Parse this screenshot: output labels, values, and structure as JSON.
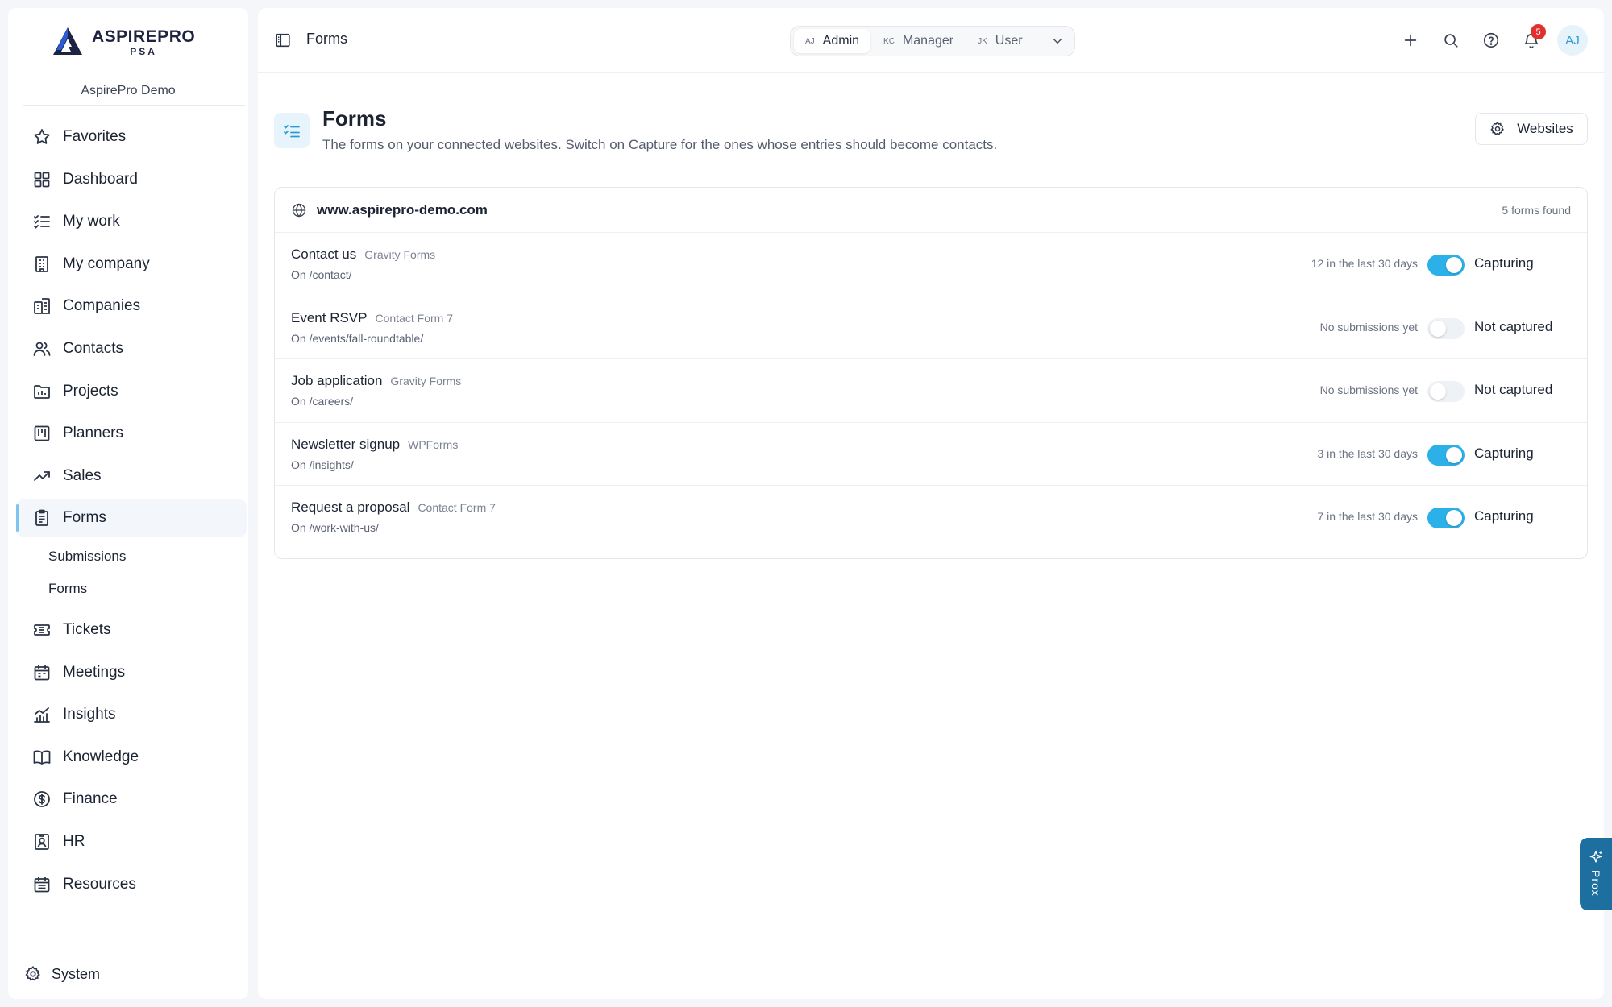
{
  "brand": {
    "name": "ASPIREPRO",
    "sub": "PSA",
    "org": "AspirePro Demo"
  },
  "sidebar": {
    "items": [
      {
        "label": "Favorites",
        "icon": "star-icon"
      },
      {
        "label": "Dashboard",
        "icon": "dashboard-icon"
      },
      {
        "label": "My work",
        "icon": "checklist-icon"
      },
      {
        "label": "My company",
        "icon": "building-icon"
      },
      {
        "label": "Companies",
        "icon": "buildings-icon"
      },
      {
        "label": "Contacts",
        "icon": "users-icon"
      },
      {
        "label": "Projects",
        "icon": "folder-chart-icon"
      },
      {
        "label": "Planners",
        "icon": "kanban-icon"
      },
      {
        "label": "Sales",
        "icon": "trending-up-icon"
      },
      {
        "label": "Forms",
        "icon": "clipboard-icon",
        "active": true
      },
      {
        "label": "Tickets",
        "icon": "ticket-icon"
      },
      {
        "label": "Meetings",
        "icon": "calendar-icon"
      },
      {
        "label": "Insights",
        "icon": "bar-chart-icon"
      },
      {
        "label": "Knowledge",
        "icon": "book-icon"
      },
      {
        "label": "Finance",
        "icon": "dollar-icon"
      },
      {
        "label": "HR",
        "icon": "id-badge-icon"
      },
      {
        "label": "Resources",
        "icon": "calendar-grid-icon"
      }
    ],
    "forms_sub": [
      "Submissions",
      "Forms"
    ],
    "system_label": "System"
  },
  "topbar": {
    "breadcrumb": "Forms",
    "roles": [
      {
        "initials": "AJ",
        "name": "Admin",
        "active": true
      },
      {
        "initials": "KC",
        "name": "Manager"
      },
      {
        "initials": "JK",
        "name": "User"
      }
    ],
    "notifications_count": "5",
    "avatar_initials": "AJ"
  },
  "page": {
    "title": "Forms",
    "description": "The forms on your connected websites. Switch on Capture for the ones whose entries should become contacts.",
    "websites_button": "Websites"
  },
  "site": {
    "domain": "www.aspirepro-demo.com",
    "count_label": "5 forms found",
    "forms": [
      {
        "name": "Contact us",
        "type": "Gravity Forms",
        "path": "On /contact/",
        "stat": "12 in the last 30 days",
        "capturing": true,
        "state": "Capturing"
      },
      {
        "name": "Event RSVP",
        "type": "Contact Form 7",
        "path": "On /events/fall-roundtable/",
        "stat": "No submissions yet",
        "capturing": false,
        "state": "Not captured"
      },
      {
        "name": "Job application",
        "type": "Gravity Forms",
        "path": "On /careers/",
        "stat": "No submissions yet",
        "capturing": false,
        "state": "Not captured"
      },
      {
        "name": "Newsletter signup",
        "type": "WPForms",
        "path": "On /insights/",
        "stat": "3 in the last 30 days",
        "capturing": true,
        "state": "Capturing"
      },
      {
        "name": "Request a proposal",
        "type": "Contact Form 7",
        "path": "On /work-with-us/",
        "stat": "7 in the last 30 days",
        "capturing": true,
        "state": "Capturing"
      }
    ]
  },
  "assistant": {
    "label": "Prox"
  },
  "colors": {
    "accent": "#2bb0e8",
    "brand": "#1d2340",
    "badge": "#e0312f"
  }
}
